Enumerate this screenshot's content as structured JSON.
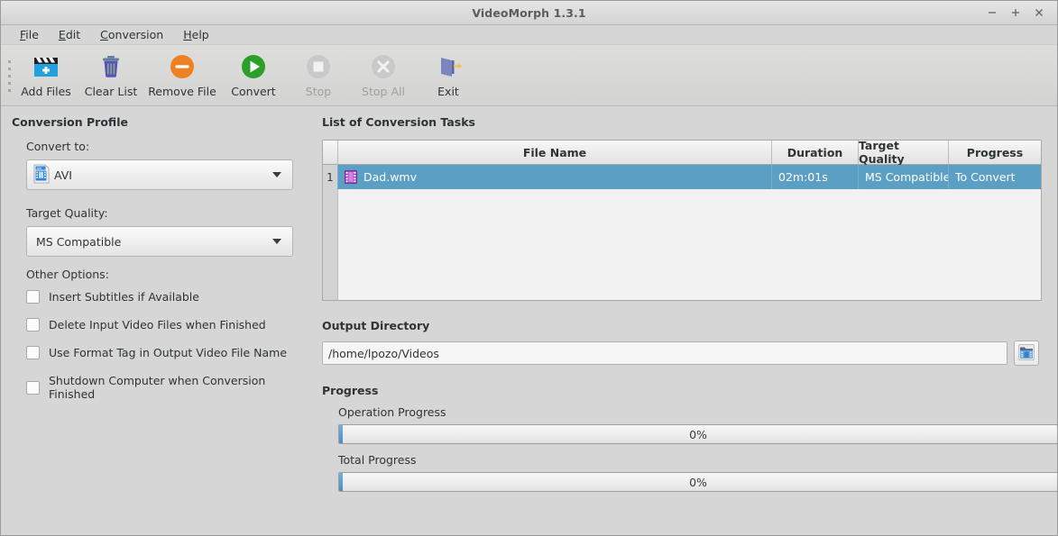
{
  "window": {
    "title": "VideoMorph 1.3.1",
    "controls": [
      {
        "name": "minimize-button",
        "glyph": "–"
      },
      {
        "name": "maximize-button",
        "glyph": "+"
      },
      {
        "name": "close-button",
        "glyph": "×"
      }
    ]
  },
  "menubar": {
    "items": [
      {
        "label": "File",
        "mnemonic": "F"
      },
      {
        "label": "Edit",
        "mnemonic": "E"
      },
      {
        "label": "Conversion",
        "mnemonic": "C"
      },
      {
        "label": "Help",
        "mnemonic": "H"
      }
    ]
  },
  "toolbar": {
    "buttons": [
      {
        "label": "Add Files",
        "icon": "add-files-icon",
        "enabled": true
      },
      {
        "label": "Clear List",
        "icon": "trash-icon",
        "enabled": true
      },
      {
        "label": "Remove File",
        "icon": "remove-file-icon",
        "enabled": true
      },
      {
        "label": "Convert",
        "icon": "play-icon",
        "enabled": true
      },
      {
        "label": "Stop",
        "icon": "stop-icon",
        "enabled": false
      },
      {
        "label": "Stop All",
        "icon": "stop-all-icon",
        "enabled": false
      },
      {
        "label": "Exit",
        "icon": "exit-door-icon",
        "enabled": true
      }
    ]
  },
  "profile": {
    "title": "Conversion Profile",
    "convert_to_label": "Convert to:",
    "convert_to_value": "AVI",
    "convert_to_icon": "avi-file-icon",
    "target_quality_label": "Target Quality:",
    "target_quality_value": "MS Compatible",
    "other_options_label": "Other Options:",
    "options": [
      {
        "label": "Insert Subtitles if Available",
        "checked": false
      },
      {
        "label": "Delete Input Video Files when Finished",
        "checked": false
      },
      {
        "label": "Use Format Tag in Output Video File Name",
        "checked": false
      },
      {
        "label": "Shutdown Computer when Conversion Finished",
        "checked": false
      }
    ]
  },
  "tasks": {
    "title": "List of Conversion Tasks",
    "columns": [
      "",
      "File Name",
      "Duration",
      "Target Quality",
      "Progress"
    ],
    "rows": [
      {
        "index": "1",
        "icon": "video-file-icon",
        "file_name": "Dad.wmv",
        "duration": "02m:01s",
        "target_quality": "MS Compatible",
        "progress": "To Convert",
        "selected": true
      }
    ]
  },
  "output": {
    "title": "Output Directory",
    "path": "/home/lpozo/Videos",
    "browse_icon": "folder-video-icon"
  },
  "progress": {
    "title": "Progress",
    "operation_label": "Operation Progress",
    "operation_value": "0%",
    "total_label": "Total Progress",
    "total_value": "0%"
  },
  "colors": {
    "selection": "#5c9fc4",
    "convert_green": "#2aa02a",
    "remove_orange": "#ef8123",
    "window_bg": "#d6d6d6"
  }
}
